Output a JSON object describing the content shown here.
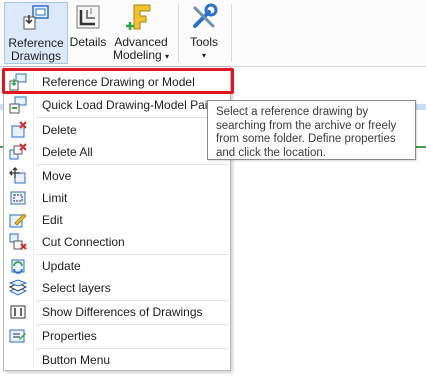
{
  "ribbon": {
    "reference_line1": "Reference",
    "reference_line2": "Drawings",
    "details": "Details",
    "advanced_line1": "Advanced",
    "advanced_line2": "Modeling",
    "tools": "Tools",
    "caret": "▾"
  },
  "menu": {
    "items": [
      {
        "label": "Reference Drawing or Model",
        "icon": "reference-drawing-icon"
      },
      {
        "label": "Quick Load Drawing-Model Pair",
        "icon": "quick-load-icon"
      },
      {
        "label": "Delete",
        "icon": "delete-icon"
      },
      {
        "label": "Delete All",
        "icon": "delete-all-icon"
      },
      {
        "label": "Move",
        "icon": "move-icon"
      },
      {
        "label": "Limit",
        "icon": "limit-icon"
      },
      {
        "label": "Edit",
        "icon": "edit-icon"
      },
      {
        "label": "Cut Connection",
        "icon": "cut-connection-icon"
      },
      {
        "label": "Update",
        "icon": "update-icon"
      },
      {
        "label": "Select layers",
        "icon": "select-layers-icon"
      },
      {
        "label": "Show Differences of Drawings",
        "icon": "show-differences-icon"
      },
      {
        "label": "Properties",
        "icon": "properties-icon"
      },
      {
        "label": "Button Menu",
        "icon": ""
      }
    ]
  },
  "tooltip": {
    "text": "Select a reference drawing by searching from the archive or freely from some folder. Define properties and click the location."
  },
  "colors": {
    "highlight_border": "#e0171f",
    "ribbon_active": "#dbe9f8",
    "icon_blue": "#2a6fc9",
    "icon_yellow": "#f2c230",
    "icon_green": "#2aa84a",
    "icon_red": "#d42a2a"
  }
}
